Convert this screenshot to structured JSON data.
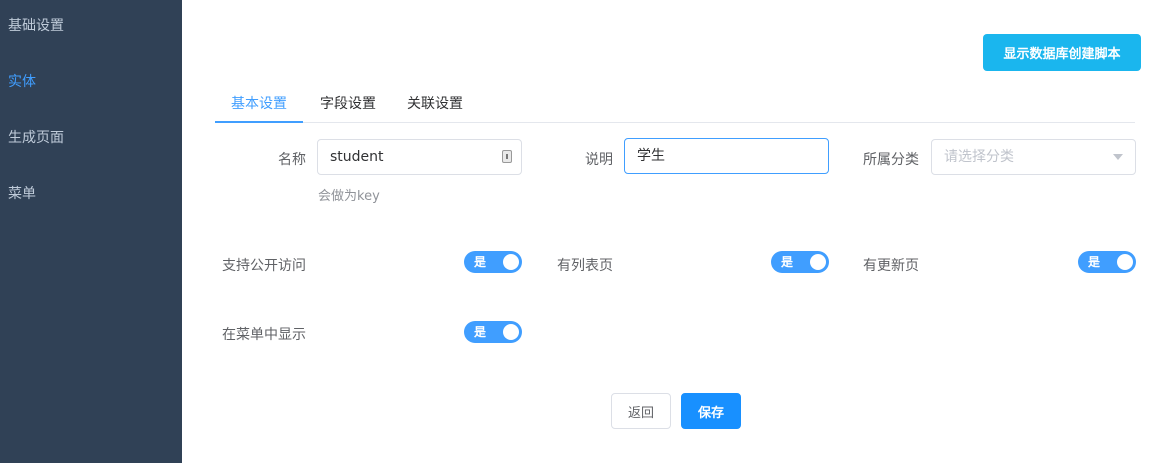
{
  "sidebar": {
    "items": [
      {
        "label": "基础设置"
      },
      {
        "label": "实体"
      },
      {
        "label": "生成页面"
      },
      {
        "label": "菜单"
      }
    ]
  },
  "header": {
    "script_button_label": "显示数据库创建脚本"
  },
  "tabs": [
    {
      "label": "基本设置"
    },
    {
      "label": "字段设置"
    },
    {
      "label": "关联设置"
    }
  ],
  "form": {
    "name": {
      "label": "名称",
      "value": "student",
      "hint": "会做为key"
    },
    "description": {
      "label": "说明",
      "value": "学生"
    },
    "category": {
      "label": "所属分类",
      "placeholder": "请选择分类"
    },
    "switches": {
      "public_access": {
        "label": "支持公开访问",
        "state_text": "是",
        "on": true
      },
      "list_page": {
        "label": "有列表页",
        "state_text": "是",
        "on": true
      },
      "update_page": {
        "label": "有更新页",
        "state_text": "是",
        "on": true
      },
      "show_in_menu": {
        "label": "在菜单中显示",
        "state_text": "是",
        "on": true
      }
    }
  },
  "actions": {
    "back_label": "返回",
    "save_label": "保存"
  },
  "colors": {
    "sidebar_bg": "#304156",
    "accent": "#409eff",
    "script_button": "#1ab6ee",
    "save_button": "#1890ff"
  }
}
